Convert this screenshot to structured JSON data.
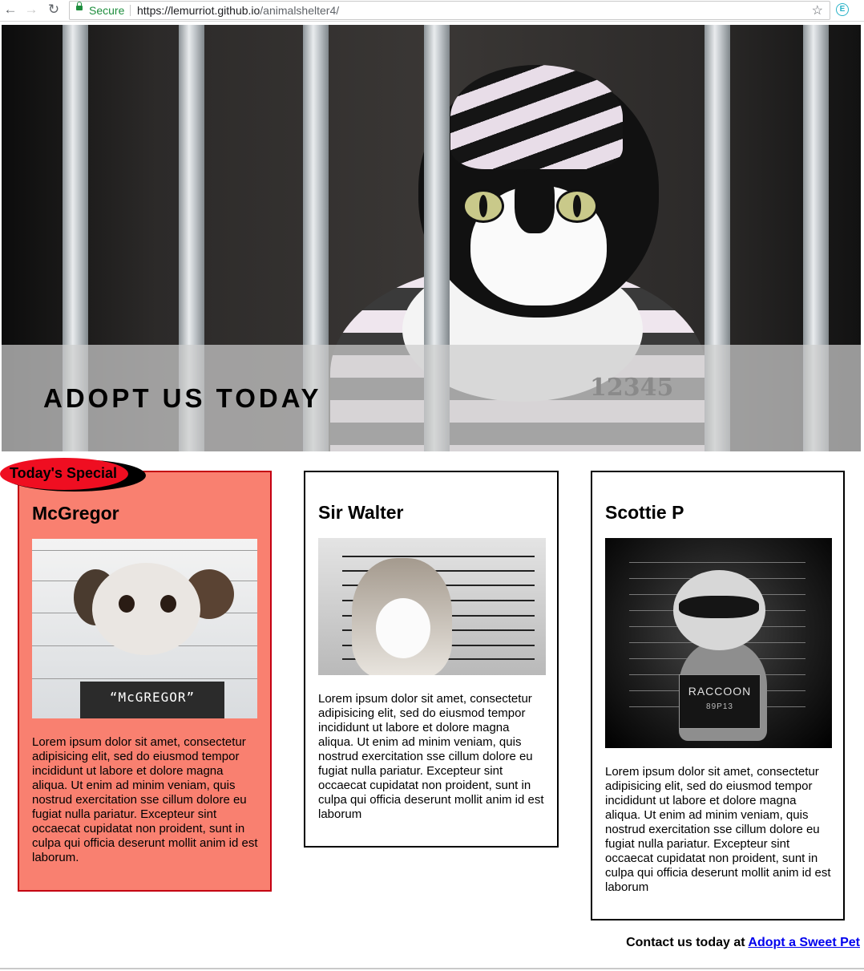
{
  "browser": {
    "secure_label": "Secure",
    "url_host": "https://lemurriot.github.io",
    "url_path": "/animalshelter4/"
  },
  "hero": {
    "title": "ADOPT US TODAY",
    "inmate_number": "12345"
  },
  "special_badge": "Today's Special",
  "pets": [
    {
      "name": "McGregor",
      "sign": "“McGREGOR”",
      "description": "Lorem ipsum dolor sit amet, consectetur adipisicing elit, sed do eiusmod tempor incididunt ut labore et dolore magna aliqua. Ut enim ad minim veniam, quis nostrud exercitation sse cillum dolore eu fugiat nulla pariatur. Excepteur sint occaecat cupidatat non proident, sunt in culpa qui officia deserunt mollit anim id est laborum."
    },
    {
      "name": "Sir Walter",
      "description": "Lorem ipsum dolor sit amet, consectetur adipisicing elit, sed do eiusmod tempor incididunt ut labore et dolore magna aliqua. Ut enim ad minim veniam, quis nostrud exercitation sse cillum dolore eu fugiat nulla pariatur. Excepteur sint occaecat cupidatat non proident, sunt in culpa qui officia deserunt mollit anim id est laborum"
    },
    {
      "name": "Scottie P",
      "sign": "RACCOON",
      "sign_number": "89P13",
      "description": "Lorem ipsum dolor sit amet, consectetur adipisicing elit, sed do eiusmod tempor incididunt ut labore et dolore magna aliqua. Ut enim ad minim veniam, quis nostrud exercitation sse cillum dolore eu fugiat nulla pariatur. Excepteur sint occaecat cupidatat non proident, sunt in culpa qui officia deserunt mollit anim id est laborum"
    }
  ],
  "footer": {
    "text": "Contact us today at",
    "link": "Adopt a Sweet Pet"
  },
  "colors": {
    "special_bg": "#f98070",
    "special_border": "#c40012",
    "badge": "#ef0e21",
    "link": "#0000ee"
  }
}
